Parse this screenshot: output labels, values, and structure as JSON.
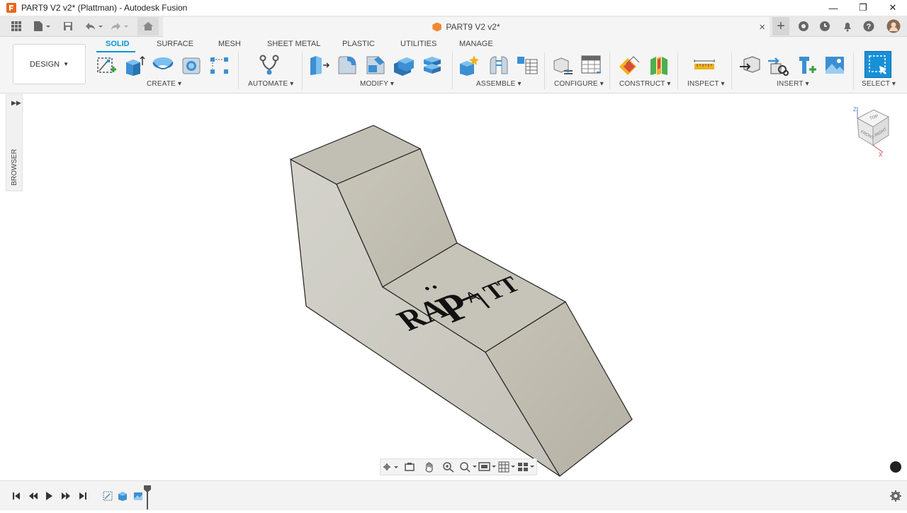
{
  "window": {
    "title": "PART9 V2 v2* (Plattman) - Autodesk Fusion",
    "minimize": "—",
    "restore": "❐",
    "close": "✕"
  },
  "tabbar": {
    "document_tab": "PART9 V2 v2*",
    "close_tab": "×",
    "new_tab": "+"
  },
  "ribbon": {
    "workspace": "DESIGN",
    "tabs": [
      "SOLID",
      "SURFACE",
      "MESH",
      "SHEET METAL",
      "PLASTIC",
      "UTILITIES",
      "MANAGE"
    ],
    "active_tab": "SOLID",
    "groups": {
      "create": "CREATE",
      "automate": "AUTOMATE",
      "modify": "MODIFY",
      "assemble": "ASSEMBLE",
      "configure": "CONFIGURE",
      "construct": "CONSTRUCT",
      "inspect": "INSPECT",
      "insert": "INSERT",
      "select": "SELECT"
    }
  },
  "browser": {
    "label": "BROWSER",
    "expand_icon": "expand-panel-icon"
  },
  "viewcube": {
    "top": "TOP",
    "front": "FRONT",
    "right": "RIGHT",
    "axis_z": "Z",
    "axis_x": "X"
  },
  "colors": {
    "accent": "#0696d7",
    "model_face_light": "#c8c6bb",
    "model_face_mid": "#b6b3a7",
    "model_face_dark": "#a19e92",
    "select_blue": "#1890d8"
  }
}
